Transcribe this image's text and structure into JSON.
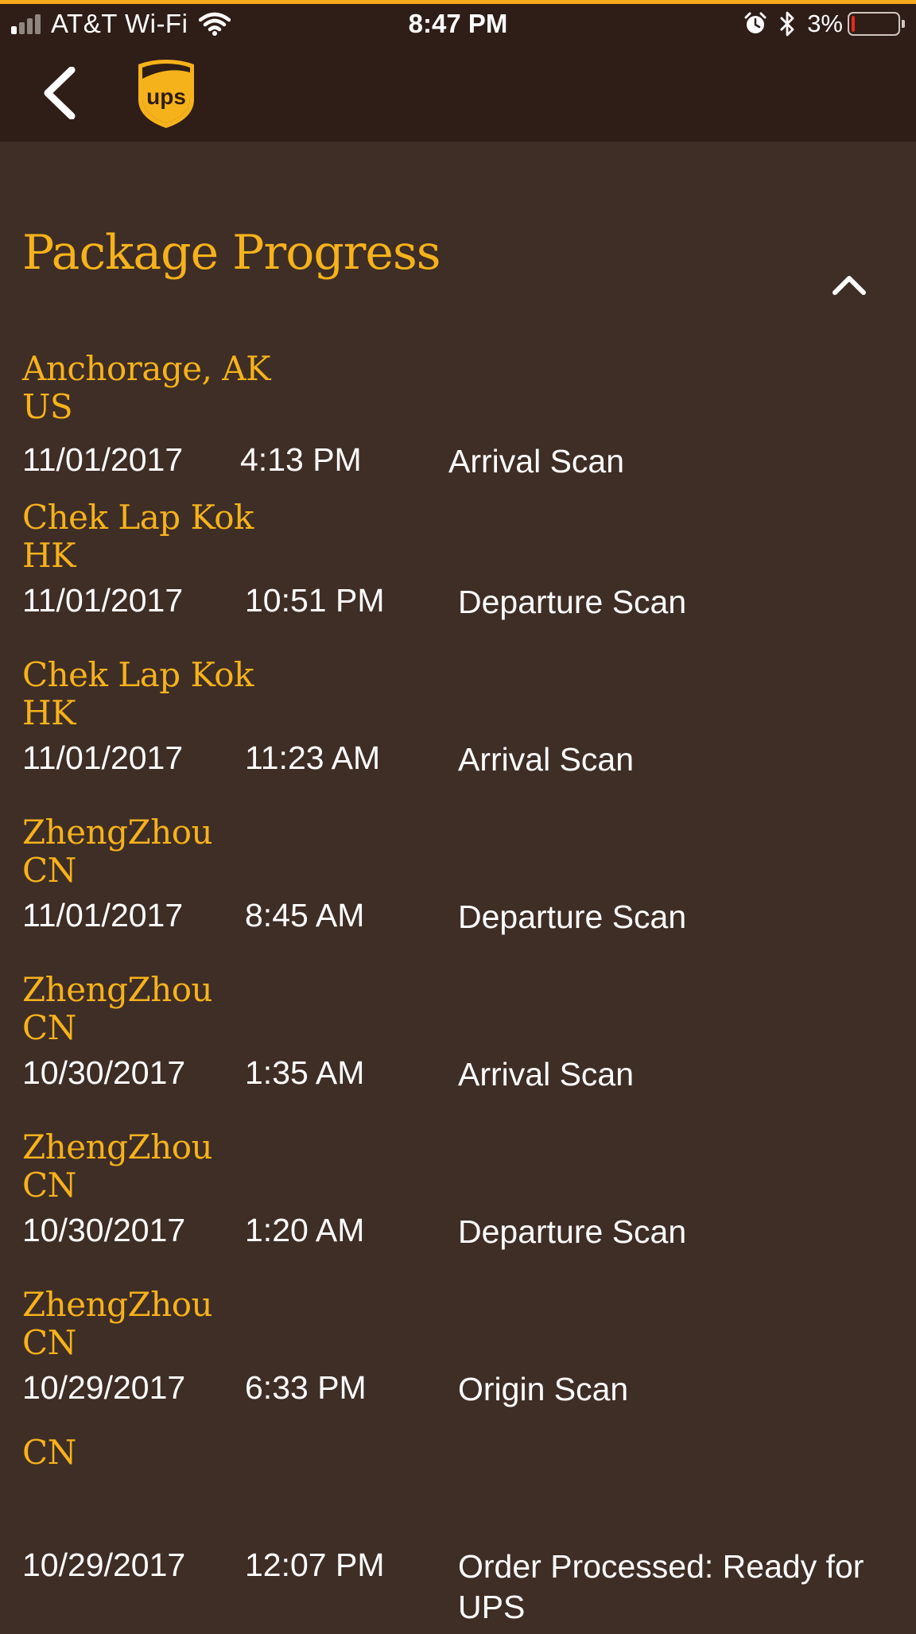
{
  "status_bar": {
    "carrier": "AT&T Wi-Fi",
    "time": "8:47 PM",
    "battery_percent": "3%"
  },
  "navbar": {
    "logo_text": "ups"
  },
  "section": {
    "title": "Package Progress"
  },
  "events": [
    {
      "city": "Anchorage, AK",
      "country": "US",
      "date": "11/01/2017",
      "time": "4:13 PM",
      "activity": "Arrival Scan"
    },
    {
      "city": "Chek Lap Kok",
      "country": "HK",
      "date": "11/01/2017",
      "time": "10:51 PM",
      "activity": "Departure Scan"
    },
    {
      "city": "Chek Lap Kok",
      "country": "HK",
      "date": "11/01/2017",
      "time": "11:23 AM",
      "activity": "Arrival Scan"
    },
    {
      "city": "ZhengZhou",
      "country": "CN",
      "date": "11/01/2017",
      "time": "8:45 AM",
      "activity": "Departure Scan"
    },
    {
      "city": "ZhengZhou",
      "country": "CN",
      "date": "10/30/2017",
      "time": "1:35 AM",
      "activity": "Arrival Scan"
    },
    {
      "city": "ZhengZhou",
      "country": "CN",
      "date": "10/30/2017",
      "time": "1:20 AM",
      "activity": "Departure Scan"
    },
    {
      "city": "ZhengZhou",
      "country": "CN",
      "date": "10/29/2017",
      "time": "6:33 PM",
      "activity": "Origin Scan"
    },
    {
      "city": "",
      "country": "CN",
      "date": "10/29/2017",
      "time": "12:07 PM",
      "activity": "Order Processed: Ready for UPS"
    }
  ],
  "colors": {
    "accent": "#f6b21b",
    "background": "#3f2e26",
    "header": "#2f1d17",
    "text": "#ffffff"
  }
}
